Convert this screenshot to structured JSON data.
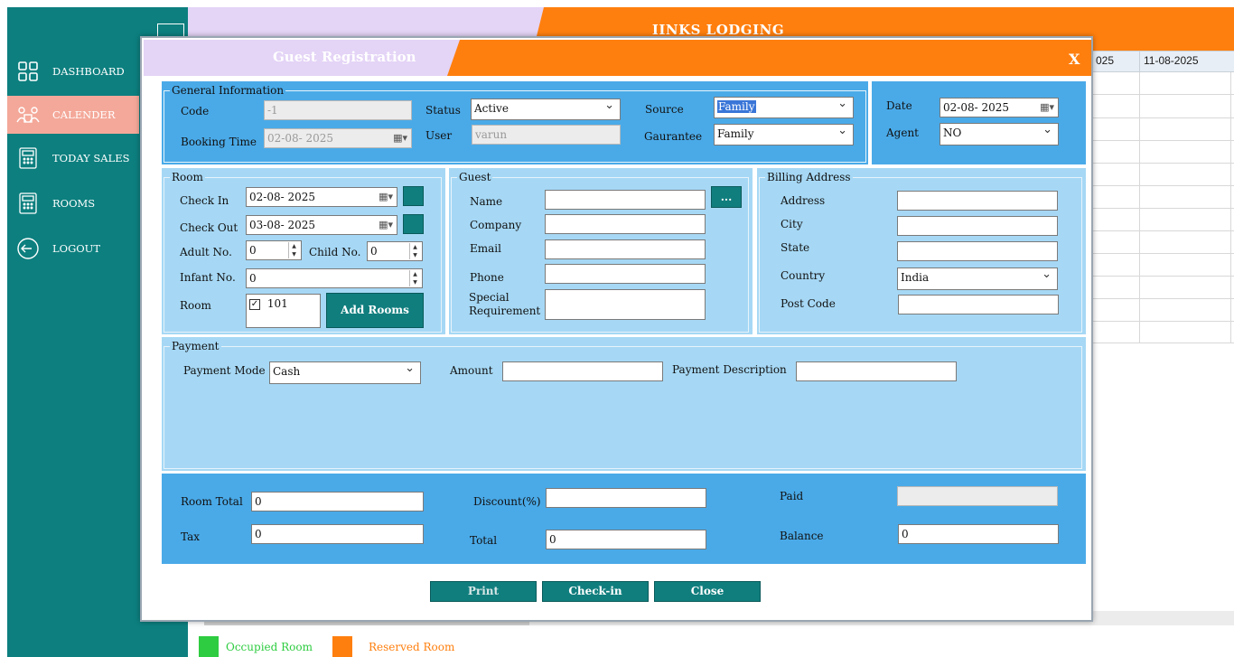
{
  "app": {
    "title": "IINKS LODGING",
    "nav": [
      {
        "label": "DASHBOARD",
        "icon": "dashboard-icon"
      },
      {
        "label": "CALENDER",
        "icon": "calendar-people-icon"
      },
      {
        "label": "TODAY SALES",
        "icon": "calculator-icon"
      },
      {
        "label": "ROOMS",
        "icon": "rooms-calculator-icon"
      },
      {
        "label": "LOGOUT",
        "icon": "logout-icon"
      }
    ],
    "calendar_columns": [
      "025",
      "11-08-2025"
    ],
    "legend": {
      "occupied": "Occupied Room",
      "reserved": "Reserved Room",
      "occupied_color": "#2ecc40",
      "reserved_color": "#ff7f0e"
    }
  },
  "dialog": {
    "title": "Guest Registration",
    "close": "X",
    "general": {
      "title": "General Information",
      "code_label": "Code",
      "code_value": "-1",
      "booking_time_label": "Booking Time",
      "booking_time_value": "02-08- 2025",
      "status_label": "Status",
      "status_value": "Active",
      "user_label": "User",
      "user_value": "varun",
      "source_label": "Source",
      "source_value": "Family",
      "guarantee_label": "Gaurantee",
      "guarantee_value": "Family"
    },
    "date_panel": {
      "date_label": "Date",
      "date_value": "02-08- 2025",
      "agent_label": "Agent",
      "agent_value": "NO"
    },
    "room": {
      "title": "Room",
      "check_in_label": "Check In",
      "check_in_value": "02-08- 2025",
      "check_out_label": "Check Out",
      "check_out_value": "03-08- 2025",
      "adult_label": "Adult No.",
      "adult_value": "0",
      "child_label": "Child No.",
      "child_value": "0",
      "infant_label": "Infant No.",
      "infant_value": "0",
      "room_label": "Room",
      "room_item": "101",
      "add_rooms": "Add Rooms"
    },
    "guest": {
      "title": "Guest",
      "name_label": "Name",
      "company_label": "Company",
      "email_label": "Email",
      "phone_label": "Phone",
      "special_label_1": "Special",
      "special_label_2": "Requirement",
      "browse": "..."
    },
    "billing": {
      "title": "Billing Address",
      "address_label": "Address",
      "city_label": "City",
      "state_label": "State",
      "country_label": "Country",
      "country_value": "India",
      "postcode_label": "Post Code"
    },
    "payment": {
      "title": "Payment",
      "mode_label": "Payment Mode",
      "mode_value": "Cash",
      "amount_label": "Amount",
      "description_label": "Payment Description"
    },
    "totals": {
      "room_total_label": "Room Total",
      "room_total_value": "0",
      "tax_label": "Tax",
      "tax_value": "0",
      "discount_label": "Discount(%)",
      "total_label": "Total",
      "total_value": "0",
      "paid_label": "Paid",
      "balance_label": "Balance",
      "balance_value": "0"
    },
    "buttons": {
      "print": "Print",
      "checkin": "Check-in",
      "close": "Close"
    }
  }
}
